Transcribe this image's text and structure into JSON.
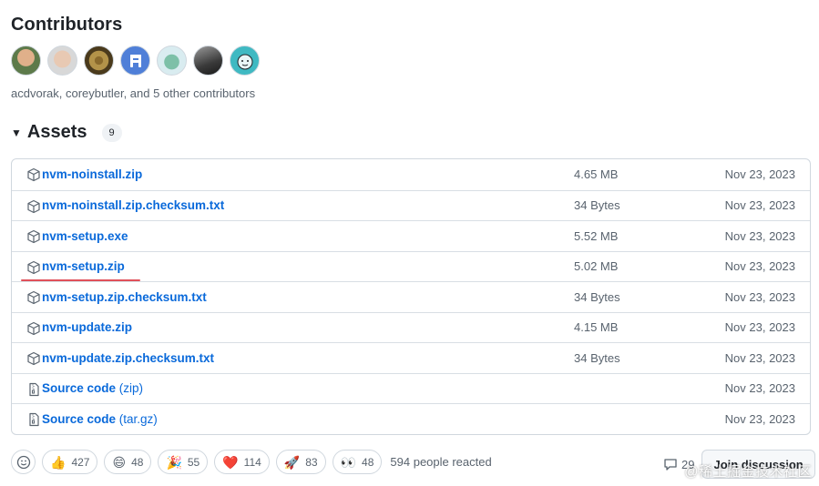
{
  "contributors": {
    "title": "Contributors",
    "avatars": [
      "acdvorak",
      "coreybutler",
      "contributor-3",
      "contributor-4",
      "contributor-5",
      "contributor-6",
      "contributor-7"
    ],
    "summary": "acdvorak, coreybutler, and 5 other contributors"
  },
  "assets": {
    "title": "Assets",
    "count": "9",
    "rows": [
      {
        "name": "nvm-noinstall.zip",
        "suffix": "",
        "size": "4.65 MB",
        "date": "Nov 23, 2023",
        "icon": "package-icon"
      },
      {
        "name": "nvm-noinstall.zip.checksum.txt",
        "suffix": "",
        "size": "34 Bytes",
        "date": "Nov 23, 2023",
        "icon": "package-icon"
      },
      {
        "name": "nvm-setup.exe",
        "suffix": "",
        "size": "5.52 MB",
        "date": "Nov 23, 2023",
        "icon": "package-icon"
      },
      {
        "name": "nvm-setup.zip",
        "suffix": "",
        "size": "5.02 MB",
        "date": "Nov 23, 2023",
        "icon": "package-icon"
      },
      {
        "name": "nvm-setup.zip.checksum.txt",
        "suffix": "",
        "size": "34 Bytes",
        "date": "Nov 23, 2023",
        "icon": "package-icon"
      },
      {
        "name": "nvm-update.zip",
        "suffix": "",
        "size": "4.15 MB",
        "date": "Nov 23, 2023",
        "icon": "package-icon"
      },
      {
        "name": "nvm-update.zip.checksum.txt",
        "suffix": "",
        "size": "34 Bytes",
        "date": "Nov 23, 2023",
        "icon": "package-icon"
      },
      {
        "name": "Source code",
        "suffix": " (zip)",
        "size": "",
        "date": "Nov 23, 2023",
        "icon": "file-zip-icon"
      },
      {
        "name": "Source code",
        "suffix": " (tar.gz)",
        "size": "",
        "date": "Nov 23, 2023",
        "icon": "file-zip-icon"
      }
    ]
  },
  "reactions": {
    "items": [
      {
        "emoji": "👍",
        "count": "427",
        "name": "thumbs-up"
      },
      {
        "emoji": "😄",
        "count": "48",
        "name": "laugh"
      },
      {
        "emoji": "🎉",
        "count": "55",
        "name": "hooray"
      },
      {
        "emoji": "❤️",
        "count": "114",
        "name": "heart"
      },
      {
        "emoji": "🚀",
        "count": "83",
        "name": "rocket"
      },
      {
        "emoji": "👀",
        "count": "48",
        "name": "eyes"
      }
    ],
    "summary": "594 people reacted"
  },
  "discussion": {
    "comments": "29",
    "join_label": "Join discussion"
  },
  "watermark": "@稀土掘金技术社区",
  "colors": {
    "link": "#0969da",
    "muted": "#59636e",
    "border": "#d0d7de",
    "highlight_underline": "#e0515a"
  }
}
